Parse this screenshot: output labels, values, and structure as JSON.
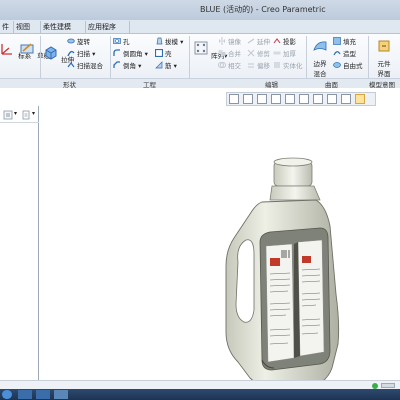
{
  "window": {
    "title": "BLUE (活动的) - Creo Parametric"
  },
  "tabs": [
    "件",
    "视图",
    "柔性建模",
    "应用程序"
  ],
  "ribbon": {
    "datum": {
      "partial_label": "标系",
      "sketch_label": "草绘"
    },
    "shapes": {
      "extrude": "拉伸",
      "revolve": "旋转",
      "sweep": "扫描",
      "swept_blend": "扫描混合"
    },
    "engineering": {
      "hole": "孔",
      "round": "倒圆角",
      "chamfer": "倒角",
      "draft": "拔模",
      "shell": "壳",
      "rib": "筋"
    },
    "pattern": "阵列",
    "editing": {
      "mirror": "镜像",
      "extend": "延伸",
      "project": "投影",
      "merge": "合并",
      "trim": "修剪",
      "offset": "偏移",
      "intersect": "相交",
      "thicken": "加厚",
      "solidify": "实体化"
    },
    "surfaces": {
      "boundary_blend_line1": "边界",
      "boundary_blend_line2": "混合",
      "fill": "填充",
      "style": "造型",
      "freestyle": "自由式"
    },
    "model_intent": {
      "line1": "元件",
      "line2": "界面"
    },
    "groups": {
      "shapes": "形状",
      "engineering": "工程",
      "editing": "编辑",
      "surfaces": "曲面",
      "model_intent": "模型意图"
    }
  },
  "colors": {
    "accent": "#2f6db5",
    "bottle": "#e6e8dc",
    "label_red": "#c0392b"
  },
  "icons": [
    "zoom-fit-icon",
    "zoom-in-icon",
    "zoom-out-icon",
    "repaint-icon",
    "orient-icon",
    "saved-views-icon",
    "display-style-icon",
    "datum-display-icon",
    "spin-center-icon",
    "annotation-display-icon"
  ]
}
